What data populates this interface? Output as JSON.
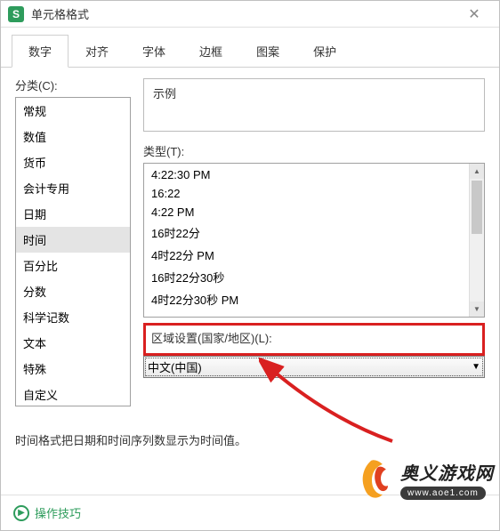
{
  "window": {
    "title": "单元格格式"
  },
  "tabs": [
    "数字",
    "对齐",
    "字体",
    "边框",
    "图案",
    "保护"
  ],
  "active_tab": 0,
  "category": {
    "label": "分类(C):",
    "items": [
      "常规",
      "数值",
      "货币",
      "会计专用",
      "日期",
      "时间",
      "百分比",
      "分数",
      "科学记数",
      "文本",
      "特殊",
      "自定义"
    ],
    "selected": 5
  },
  "sample": {
    "label": "示例",
    "value": ""
  },
  "type": {
    "label": "类型(T):",
    "items": [
      "4:22:30 PM",
      "16:22",
      "4:22 PM",
      "16时22分",
      "4时22分 PM",
      "16时22分30秒",
      "4时22分30秒 PM"
    ]
  },
  "locale": {
    "label": "区域设置(国家/地区)(L):",
    "value": "中文(中国)"
  },
  "hint": "时间格式把日期和时间序列数显示为时间值。",
  "footer": {
    "tip": "操作技巧"
  },
  "watermark": {
    "title": "奥义游戏网",
    "url": "www.aoe1.com"
  }
}
